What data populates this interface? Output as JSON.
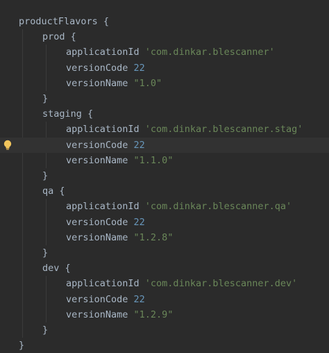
{
  "editor": {
    "lines": [
      {
        "indent": 0,
        "tokens": [
          {
            "text": "productFlavors {",
            "kind": "plain"
          }
        ]
      },
      {
        "indent": 1,
        "tokens": [
          {
            "text": "prod {",
            "kind": "plain"
          }
        ]
      },
      {
        "indent": 2,
        "tokens": [
          {
            "text": "applicationId ",
            "kind": "plain"
          },
          {
            "text": "'com.dinkar.blescanner'",
            "kind": "str"
          }
        ]
      },
      {
        "indent": 2,
        "tokens": [
          {
            "text": "versionCode ",
            "kind": "plain"
          },
          {
            "text": "22",
            "kind": "num"
          }
        ]
      },
      {
        "indent": 2,
        "tokens": [
          {
            "text": "versionName ",
            "kind": "plain"
          },
          {
            "text": "\"1.0\"",
            "kind": "str"
          }
        ]
      },
      {
        "indent": 1,
        "tokens": [
          {
            "text": "}",
            "kind": "plain"
          }
        ]
      },
      {
        "indent": 1,
        "tokens": [
          {
            "text": "staging {",
            "kind": "plain"
          }
        ]
      },
      {
        "indent": 2,
        "tokens": [
          {
            "text": "applicationId ",
            "kind": "plain"
          },
          {
            "text": "'com.dinkar.blescanner.stag'",
            "kind": "str"
          }
        ]
      },
      {
        "indent": 2,
        "caret": true,
        "bulb": true,
        "tokens": [
          {
            "text": "versionCode ",
            "kind": "plain"
          },
          {
            "text": "22",
            "kind": "num"
          }
        ]
      },
      {
        "indent": 2,
        "tokens": [
          {
            "text": "versionName ",
            "kind": "plain"
          },
          {
            "text": "\"1.1.0\"",
            "kind": "str"
          }
        ]
      },
      {
        "indent": 1,
        "tokens": [
          {
            "text": "}",
            "kind": "plain"
          }
        ]
      },
      {
        "indent": 1,
        "tokens": [
          {
            "text": "qa {",
            "kind": "plain"
          }
        ]
      },
      {
        "indent": 2,
        "tokens": [
          {
            "text": "applicationId ",
            "kind": "plain"
          },
          {
            "text": "'com.dinkar.blescanner.qa'",
            "kind": "str"
          }
        ]
      },
      {
        "indent": 2,
        "tokens": [
          {
            "text": "versionCode ",
            "kind": "plain"
          },
          {
            "text": "22",
            "kind": "num"
          }
        ]
      },
      {
        "indent": 2,
        "tokens": [
          {
            "text": "versionName ",
            "kind": "plain"
          },
          {
            "text": "\"1.2.8\"",
            "kind": "str"
          }
        ]
      },
      {
        "indent": 1,
        "tokens": [
          {
            "text": "}",
            "kind": "plain"
          }
        ]
      },
      {
        "indent": 1,
        "tokens": [
          {
            "text": "dev {",
            "kind": "plain"
          }
        ]
      },
      {
        "indent": 2,
        "tokens": [
          {
            "text": "applicationId ",
            "kind": "plain"
          },
          {
            "text": "'com.dinkar.blescanner.dev'",
            "kind": "str"
          }
        ]
      },
      {
        "indent": 2,
        "tokens": [
          {
            "text": "versionCode ",
            "kind": "plain"
          },
          {
            "text": "22",
            "kind": "num"
          }
        ]
      },
      {
        "indent": 2,
        "tokens": [
          {
            "text": "versionName ",
            "kind": "plain"
          },
          {
            "text": "\"1.2.9\"",
            "kind": "str"
          }
        ]
      },
      {
        "indent": 1,
        "tokens": [
          {
            "text": "}",
            "kind": "plain"
          }
        ]
      },
      {
        "indent": 0,
        "tokens": [
          {
            "text": "}",
            "kind": "plain"
          }
        ]
      }
    ]
  },
  "colors": {
    "background": "#2b2b2b",
    "caret_row": "#323232",
    "plain": "#a9b7c6",
    "string": "#6a8759",
    "number": "#6897bb",
    "bulb": "#f2c55c"
  },
  "icons": {
    "intention_bulb": "lightbulb-icon"
  }
}
